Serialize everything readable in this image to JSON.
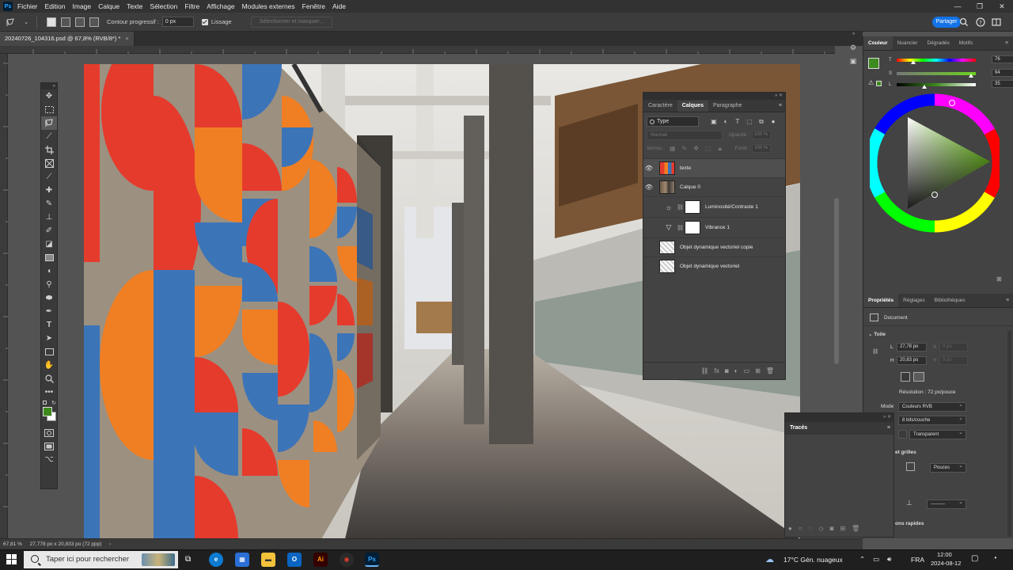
{
  "app": {
    "logo": "Ps"
  },
  "menu": [
    "Fichier",
    "Edition",
    "Image",
    "Calque",
    "Texte",
    "Sélection",
    "Filtre",
    "Affichage",
    "Modules externes",
    "Fenêtre",
    "Aide"
  ],
  "options": {
    "feather_label": "Contour progressif :",
    "feather_value": "0 px",
    "smoothing_label": "Lissage",
    "select_mask_label": "Sélectionner et masquer...",
    "share_label": "Partager"
  },
  "document": {
    "tab_title": "20240726_104316.psd @ 67,8% (RVB/8*) *",
    "close": "×"
  },
  "layers_panel": {
    "tabs": [
      "Caractère",
      "Calques",
      "Paragraphe"
    ],
    "active_tab": "Calques",
    "filter_label": "Type",
    "blend_mode": "Normal",
    "opacity_label": "Opacité :",
    "opacity_value": "100 %",
    "lock_label": "Verrou :",
    "fill_label": "Fond :",
    "fill_value": "100 %",
    "layers": [
      {
        "name": "texte",
        "visible": true,
        "kind": "pattern"
      },
      {
        "name": "Calque 0",
        "visible": true,
        "kind": "photo"
      },
      {
        "name": "Luminosité/Contraste 1",
        "visible": false,
        "kind": "adjust-brightness"
      },
      {
        "name": "Vibrance 1",
        "visible": false,
        "kind": "adjust-vibrance"
      },
      {
        "name": "Objet dynamique vectoriel copie",
        "visible": false,
        "kind": "smart"
      },
      {
        "name": "Objet dynamique vectoriel",
        "visible": false,
        "kind": "smart"
      }
    ]
  },
  "color_panel": {
    "tabs": [
      "Couleur",
      "Nuancier",
      "Dégradés",
      "Motifs"
    ],
    "active_tab": "Couleur",
    "t_label": "T",
    "t_value": "76",
    "t_level": 0.21,
    "s_label": "S",
    "s_value": "94",
    "s_level": 0.94,
    "l_label": "L",
    "l_value": "35",
    "l_level": 0.35
  },
  "properties_panel": {
    "tabs": [
      "Propriétés",
      "Réglages",
      "Bibliothèques"
    ],
    "active_tab": "Propriétés",
    "doc_label": "Document",
    "section_canvas": "Toile",
    "l_label": "L",
    "width": "27,78 po",
    "h_label": "H",
    "height": "20,83 po",
    "x_label": "X",
    "x_value": "0 po",
    "y_label": "Y",
    "y_value": "0 po",
    "resolution": "Résolution : 72 px/pouce",
    "mode_label": "Mode",
    "mode_value": "Couleurs RVB",
    "bit_depth": "8 bits/couche",
    "background": "Transparent",
    "grid_section": "et grilles",
    "units": "Pouces",
    "quick_actions": "ons rapides"
  },
  "traces_panel": {
    "title": "Tracés"
  },
  "status": {
    "zoom": "67,81 %",
    "doc_size": "27,778 po x 20,833 po (72 ppp)"
  },
  "taskbar": {
    "search_placeholder": "Taper ici pour rechercher",
    "weather": "17°C  Gén. nuageux",
    "language": "FRA",
    "time": "12:00",
    "date": "2024-08-12"
  },
  "colors": {
    "accent": "#1473e6",
    "foreground": "#3d8a1e",
    "background_swatch": "#ffffff"
  }
}
